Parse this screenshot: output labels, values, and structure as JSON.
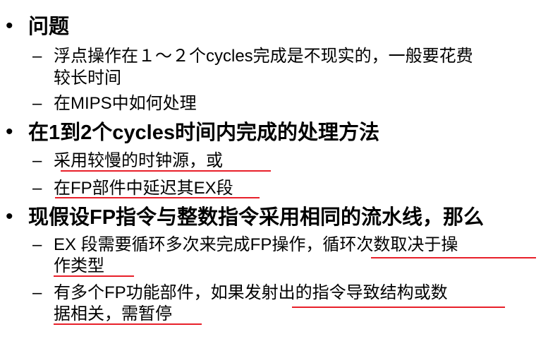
{
  "items": [
    {
      "text": "问题",
      "subitems": [
        {
          "line1": "浮点操作在１～２个cycles完成是不现实的，一般要花费",
          "line2": "较长时间"
        },
        {
          "line1": "在MIPS中如何处理"
        }
      ]
    },
    {
      "text": "在1到2个cycles时间内完成的处理方法",
      "subitems": [
        {
          "line1": "采用较慢的时钟源，或"
        },
        {
          "line1": "在FP部件中延迟其EX段"
        }
      ]
    },
    {
      "text": "现假设FP指令与整数指令采用相同的流水线，那么",
      "subitems": [
        {
          "line1": "EX 段需要循环多次来完成FP操作，循环次数取决于操",
          "line2": "作类型"
        },
        {
          "line1": "有多个FP功能部件，如果发射出的指令导致结构或数",
          "line2": "据相关，需暂停"
        }
      ]
    }
  ],
  "bullet_symbol": "•",
  "dash_symbol": "–",
  "colors": {
    "text": "#000000",
    "underline": "#e8202a",
    "background": "#ffffff"
  }
}
